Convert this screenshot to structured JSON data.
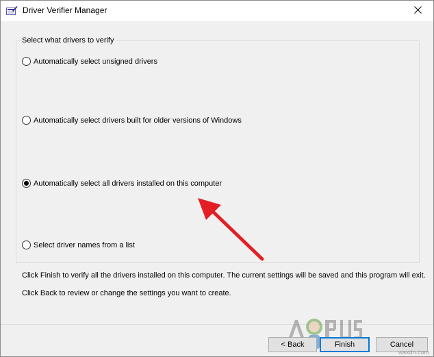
{
  "window": {
    "title": "Driver Verifier Manager"
  },
  "icons": {
    "app": "driver-verifier-app-icon",
    "close": "close-icon",
    "annotation": "red-arrow"
  },
  "group": {
    "legend": "Select what drivers to verify",
    "options": [
      {
        "label": "Automatically select unsigned drivers",
        "selected": false
      },
      {
        "label": "Automatically select drivers built for older versions of Windows",
        "selected": false
      },
      {
        "label": "Automatically select all drivers installed on this computer",
        "selected": true
      },
      {
        "label": "Select driver names from a list",
        "selected": false
      }
    ]
  },
  "info": {
    "finish_text": "Click Finish to verify all the drivers installed on this computer. The current settings will be saved and this program will exit.",
    "back_text": "Click Back to review or change the settings you want to create."
  },
  "buttons": {
    "back": "< Back",
    "finish": "Finish",
    "cancel": "Cancel"
  },
  "watermark": {
    "logo_text": "APPUALS",
    "site": "wsxdn.com"
  },
  "colors": {
    "arrow": "#e31e24",
    "default_button_border": "#0078d7"
  }
}
